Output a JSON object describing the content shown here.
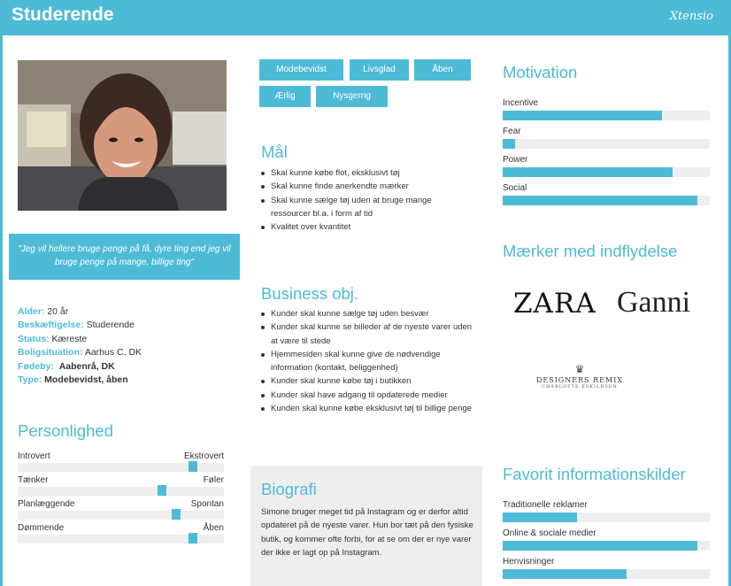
{
  "header": {
    "title": "Studerende",
    "brand": "Xtensio"
  },
  "quote": "\"Jeg vil hellere bruge penge på få, dyre ting end jeg vil bruge penge på mange, billige ting\"",
  "facts": [
    {
      "key": "Alder:",
      "value": "20 år"
    },
    {
      "key": "Beskæftigelse:",
      "value": "Studerende"
    },
    {
      "key": "Status:",
      "value": "Kæreste"
    },
    {
      "key": "Boligsituation:",
      "value": "Aarhus C, DK"
    },
    {
      "key": "Fødeby:",
      "value": "Aabenrå, DK"
    },
    {
      "key": "Type:",
      "value": "Modebevidst, åben"
    }
  ],
  "personality": {
    "title": "Personlighed",
    "traits": [
      {
        "left": "Introvert",
        "right": "Ekstrovert",
        "level": 0.85
      },
      {
        "left": "Tænker",
        "right": "Føler",
        "level": 0.7
      },
      {
        "left": "Planlæggende",
        "right": "Spontan",
        "level": 0.77
      },
      {
        "left": "Dømmende",
        "right": "Åben",
        "level": 0.85
      }
    ]
  },
  "tags": [
    "Modebevidst",
    "Livsglad",
    "Åben",
    "Ærlig",
    "Nysgerrig"
  ],
  "goals": {
    "title": "Mål",
    "items": [
      "Skal kunne købe flot, eksklusivt tøj",
      "Skal kunne finde anerkendte mærker",
      "Skal kunne sælge tøj uden at bruge mange ressourcer bl.a. i form af tid",
      "Kvalitet over kvantitet"
    ]
  },
  "business": {
    "title": "Business obj.",
    "items": [
      "Kunder skal kunne sælge tøj uden besvær",
      "Kunder skal kunne se billeder af de nyeste varer uden at være til stede",
      "Hjemmesiden skal kunne give de nødvendige information (kontakt, beliggenhed)",
      "Kunder skal kunne købe tøj i butikken",
      "Kunder skal have adgang til opdaterede medier",
      "Kunden skal kunne købe eksklusivt tøj til billige penge"
    ]
  },
  "biography": {
    "title": "Biografi",
    "text": "Simone bruger meget tid på Instagram og er derfor altid opdateret på de nyeste varer. Hun bor tæt på den fysiske butik, og kommer ofte forbi, for at se om der er nye varer der ikke er lagt op på Instagram."
  },
  "motivation": {
    "title": "Motivation",
    "items": [
      {
        "label": "Incentive",
        "value": 0.77
      },
      {
        "label": "Fear",
        "value": 0.06
      },
      {
        "label": "Power",
        "value": 0.82
      },
      {
        "label": "Social",
        "value": 0.94
      }
    ]
  },
  "brands": {
    "title": "Mærker med indflydelse",
    "logos": {
      "zara": "ZARA",
      "ganni": "Ganni",
      "remix_name": "DESIGNERS REMIX",
      "remix_sub": "CHARLOTTE ESKILDSEN"
    }
  },
  "sources": {
    "title": "Favorit informationskilder",
    "items": [
      {
        "label": "Traditionelle reklamer",
        "value": 0.36
      },
      {
        "label": "Online & sociale medier",
        "value": 0.94
      },
      {
        "label": "Henvisninger",
        "value": 0.6
      }
    ]
  },
  "colors": {
    "accent": "#4dbbd5",
    "track": "#eeeeee"
  }
}
